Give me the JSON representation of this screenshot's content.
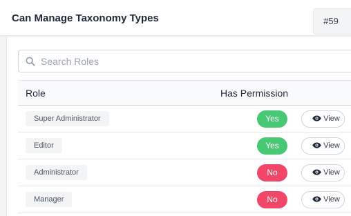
{
  "header": {
    "title": "Can Manage Taxonomy Types",
    "id_badge": "#59"
  },
  "search": {
    "placeholder": "Search Roles",
    "value": ""
  },
  "table": {
    "columns": [
      "Role",
      "Has Permission"
    ],
    "rows": [
      {
        "role": "Super Administrator",
        "permission": "Yes",
        "action": "View"
      },
      {
        "role": "Editor",
        "permission": "Yes",
        "action": "View"
      },
      {
        "role": "Administrator",
        "permission": "No",
        "action": "View"
      },
      {
        "role": "Manager",
        "permission": "No",
        "action": "View"
      }
    ]
  },
  "colors": {
    "yes": "#48c774",
    "no": "#f14668"
  },
  "icons": {
    "search": "search-icon",
    "view": "eye-icon"
  }
}
